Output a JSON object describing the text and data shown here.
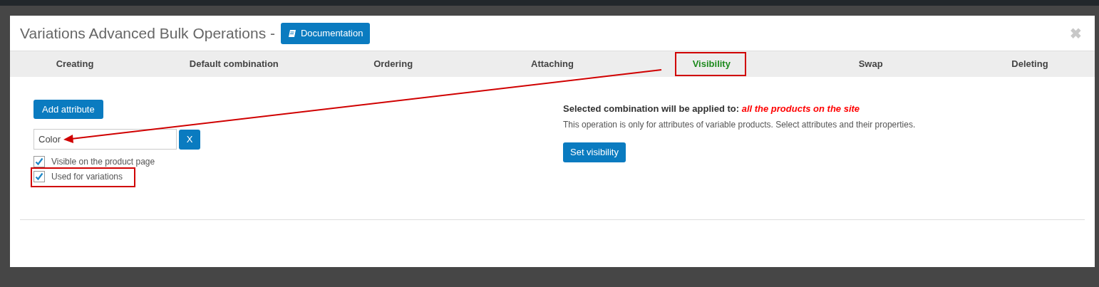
{
  "dialog": {
    "title": "Variations Advanced Bulk Operations -",
    "doc_button": "Documentation",
    "close": "✖"
  },
  "tabs": [
    {
      "label": "Creating",
      "selected": false
    },
    {
      "label": "Default combination",
      "selected": false
    },
    {
      "label": "Ordering",
      "selected": false
    },
    {
      "label": "Attaching",
      "selected": false
    },
    {
      "label": "Visibility",
      "selected": true
    },
    {
      "label": "Swap",
      "selected": false
    },
    {
      "label": "Deleting",
      "selected": false
    }
  ],
  "attributes": {
    "add_button": "Add attribute",
    "field_value": "Color",
    "remove_button": "X",
    "options": [
      {
        "label": "Visible on the product page",
        "checked": true
      },
      {
        "label": "Used for variations",
        "checked": true
      }
    ]
  },
  "summary": {
    "label": "Selected combination will be applied to:",
    "target": "all the products on the site",
    "note": "This operation is only for attributes of variable products. Select attributes and their properties.",
    "action_button": "Set visibility"
  }
}
